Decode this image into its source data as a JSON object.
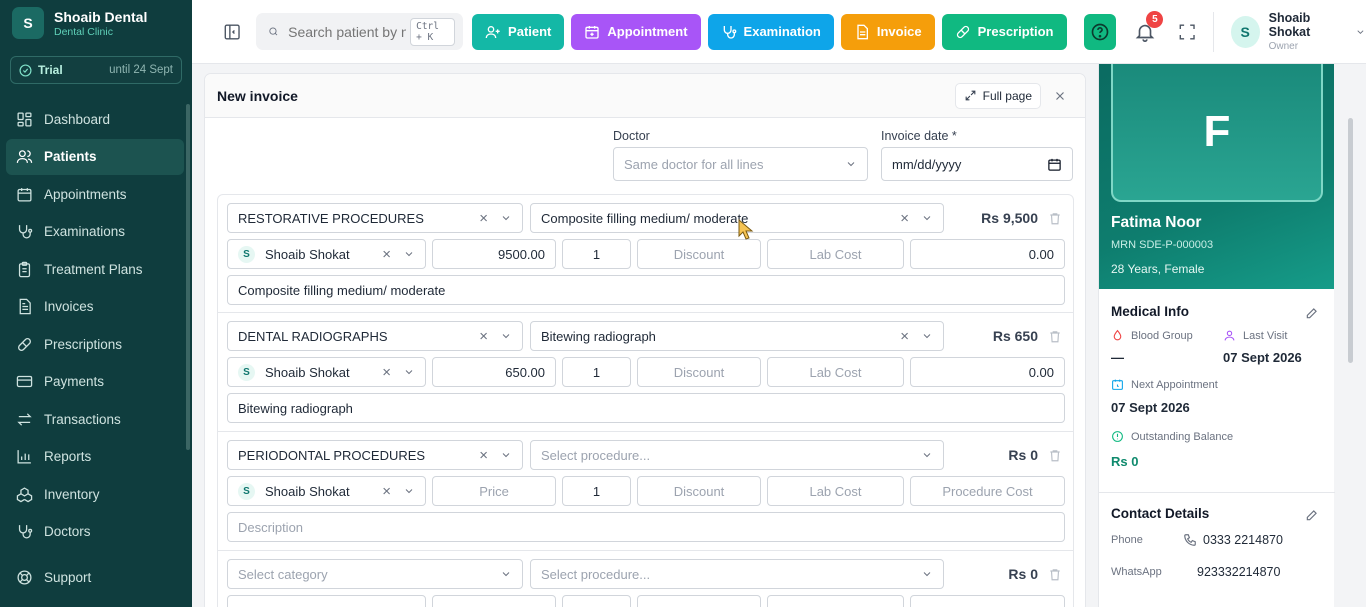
{
  "brand": {
    "initial": "S",
    "name": "Shoaib Dental",
    "sub": "Dental Clinic"
  },
  "trial": {
    "label": "Trial",
    "until": "until 24 Sept"
  },
  "sidebar": {
    "items": [
      {
        "label": "Dashboard"
      },
      {
        "label": "Patients"
      },
      {
        "label": "Appointments"
      },
      {
        "label": "Examinations"
      },
      {
        "label": "Treatment Plans"
      },
      {
        "label": "Invoices"
      },
      {
        "label": "Prescriptions"
      },
      {
        "label": "Payments"
      },
      {
        "label": "Transactions"
      },
      {
        "label": "Reports"
      },
      {
        "label": "Inventory"
      },
      {
        "label": "Doctors"
      }
    ],
    "support": "Support",
    "active_index": 1
  },
  "topbar": {
    "search_placeholder": "Search patient by name",
    "search_shortcut": "Ctrl + K",
    "quick": {
      "patient": "Patient",
      "appointment": "Appointment",
      "examination": "Examination",
      "invoice": "Invoice",
      "prescription": "Prescription"
    },
    "colors": {
      "patient": "#14b8a6",
      "appointment": "#a855f7",
      "examination": "#0ea5e9",
      "invoice": "#f59e0b",
      "prescription": "#10b981"
    },
    "notifications": "5",
    "user": {
      "initial": "S",
      "name": "Shoaib Shokat",
      "role": "Owner"
    }
  },
  "invoice": {
    "title": "New invoice",
    "full_page": "Full page",
    "doctor_label": "Doctor",
    "doctor_placeholder": "Same doctor for all lines",
    "date_label": "Invoice date *",
    "date_placeholder": "mm/dd/yyyy",
    "lines": [
      {
        "category": "RESTORATIVE PROCEDURES",
        "procedure": "Composite filling medium/ moderate",
        "amount": "Rs 9,500",
        "doctor_initial": "S",
        "doctor": "Shoaib Shokat",
        "price": "9500.00",
        "qty": "1",
        "discount": "Discount",
        "lab_cost": "Lab Cost",
        "proc_cost": "0.00",
        "description": "Composite filling medium/ moderate"
      },
      {
        "category": "DENTAL RADIOGRAPHS",
        "procedure": "Bitewing radiograph",
        "amount": "Rs 650",
        "doctor_initial": "S",
        "doctor": "Shoaib Shokat",
        "price": "650.00",
        "qty": "1",
        "discount": "Discount",
        "lab_cost": "Lab Cost",
        "proc_cost": "0.00",
        "description": "Bitewing radiograph"
      },
      {
        "category": "PERIODONTAL PROCEDURES",
        "procedure": "Select procedure...",
        "amount": "Rs 0",
        "doctor_initial": "S",
        "doctor": "Shoaib Shokat",
        "price": "Price",
        "qty": "1",
        "discount": "Discount",
        "lab_cost": "Lab Cost",
        "proc_cost": "Procedure Cost",
        "description": "Description"
      },
      {
        "category": "Select category",
        "procedure": "Select procedure...",
        "amount": "Rs 0"
      }
    ]
  },
  "patient": {
    "initial": "F",
    "name": "Fatima Noor",
    "mrn": "MRN SDE-P-000003",
    "age_sex": "28 Years, Female",
    "medical_title": "Medical Info",
    "blood_group_label": "Blood Group",
    "blood_group": "—",
    "last_visit_label": "Last Visit",
    "last_visit": "07 Sept 2026",
    "next_appt_label": "Next Appointment",
    "next_appt": "07 Sept 2026",
    "balance_label": "Outstanding Balance",
    "balance": "Rs 0",
    "contact_title": "Contact Details",
    "phone_label": "Phone",
    "phone": "0333 2214870",
    "whatsapp_label": "WhatsApp",
    "whatsapp": "923332214870"
  }
}
